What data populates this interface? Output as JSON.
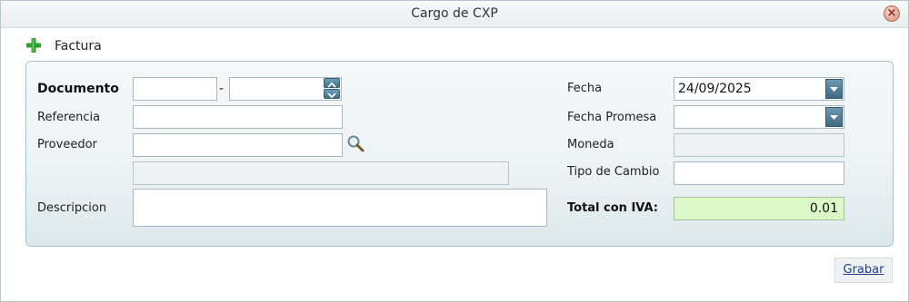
{
  "window": {
    "title": "Cargo de CXP",
    "close_symbol": "×"
  },
  "section": {
    "label": "Factura",
    "icon": "plus-icon",
    "icon_color": "#2e9e2e"
  },
  "form": {
    "documento": {
      "label": "Documento",
      "value_1": "",
      "value_2": "",
      "separator": "-"
    },
    "referencia": {
      "label": "Referencia",
      "value": ""
    },
    "proveedor": {
      "label": "Proveedor",
      "value": "",
      "name_value": ""
    },
    "descripcion": {
      "label": "Descripcion",
      "value": ""
    },
    "fecha": {
      "label": "Fecha",
      "value": "24/09/2025"
    },
    "fecha_promesa": {
      "label": "Fecha Promesa",
      "value": ""
    },
    "moneda": {
      "label": "Moneda",
      "value": ""
    },
    "tipo_cambio": {
      "label": "Tipo de Cambio",
      "value": ""
    },
    "total_iva": {
      "label": "Total con IVA:",
      "value": "0.01",
      "bg_color": "#dcf7c8"
    }
  },
  "actions": {
    "save_label": "Grabar"
  }
}
